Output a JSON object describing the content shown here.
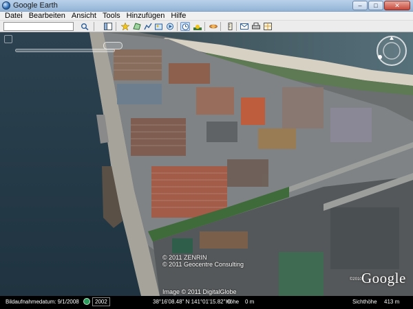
{
  "window": {
    "title": "Google Earth",
    "controls": {
      "minimize": "–",
      "maximize": "□",
      "close": "✕"
    }
  },
  "menu": {
    "items": [
      "Datei",
      "Bearbeiten",
      "Ansicht",
      "Tools",
      "Hinzufügen",
      "Hilfe"
    ]
  },
  "toolbar": {
    "search_value": "",
    "dropdown_icon": "chevron-down-icon",
    "buttons": [
      "search-icon",
      "sidebar-icon",
      "placemark-icon",
      "polygon-icon",
      "path-icon",
      "image-overlay-icon",
      "tour-icon",
      "historical-imagery-icon",
      "sun-icon",
      "planet-icon",
      "ruler-icon",
      "email-icon",
      "print-icon",
      "view-in-maps-icon"
    ]
  },
  "map": {
    "slider_thumb": "",
    "attribution": [
      "© 2011 ZENRIN",
      "© 2011 Geocentre Consulting"
    ],
    "image_credit": "Image © 2011 DigitalGlobe",
    "logo": "Google",
    "logo_small": "©2010"
  },
  "statusbar": {
    "imagery_date_label": "Bildaufnahmedatum: 9/1/2008",
    "year": "2002",
    "coordinates": "38°16'08.48\" N  141°01'15.82\" O",
    "elevation_label": "Höhe",
    "elevation_value": "0 m",
    "eye_alt_label": "Sichthöhe",
    "eye_alt_value": "413 m"
  },
  "colors": {
    "water": "#2f4552",
    "sand": "#d8d3c4",
    "pavement": "#7b7f82",
    "vegetation": "#3f6a3a",
    "accent": "#3a77c2"
  }
}
